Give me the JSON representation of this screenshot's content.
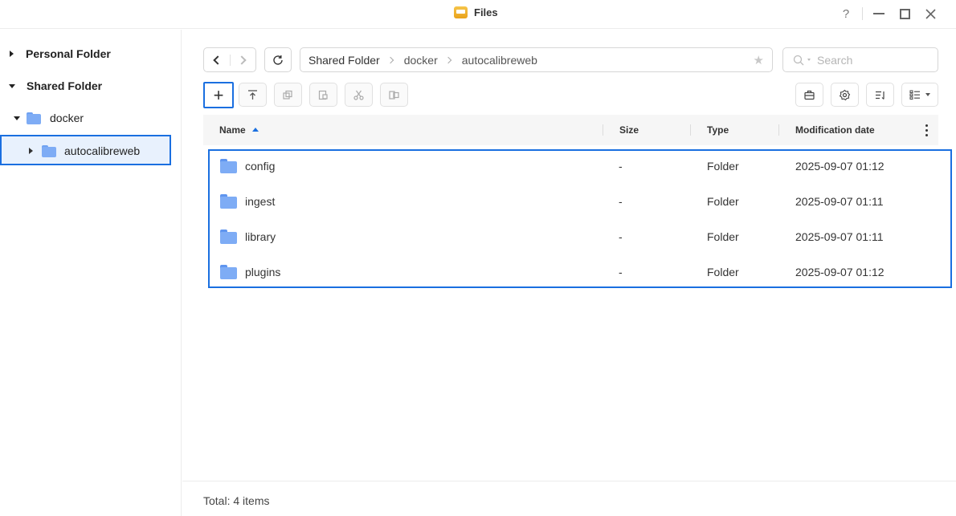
{
  "app": {
    "title": "Files",
    "icon": "files-app-icon"
  },
  "window_controls": {
    "help_label": "?"
  },
  "sidebar": {
    "items": [
      {
        "label": "Personal Folder",
        "expanded": false
      },
      {
        "label": "Shared Folder",
        "expanded": true
      },
      {
        "label": "docker",
        "expanded": true
      },
      {
        "label": "autocalibreweb",
        "expanded": false,
        "selected": true
      }
    ]
  },
  "path": {
    "crumbs": [
      "Shared Folder",
      "docker",
      "autocalibreweb"
    ]
  },
  "search": {
    "placeholder": "Search",
    "value": ""
  },
  "toolbar": {
    "create_label": "+",
    "icons": [
      "upload-icon",
      "copy-icon",
      "paste-icon",
      "cut-icon",
      "move-icon"
    ],
    "right_icons": [
      "briefcase-icon",
      "settings-icon",
      "sort-icon",
      "list-view-icon"
    ]
  },
  "table": {
    "columns": {
      "name": "Name",
      "size": "Size",
      "type": "Type",
      "modified": "Modification date"
    },
    "sort": {
      "column": "Name",
      "direction": "ascending"
    },
    "rows": [
      {
        "name": "config",
        "size": "-",
        "type": "Folder",
        "modified": "2025-09-07 01:12"
      },
      {
        "name": "ingest",
        "size": "-",
        "type": "Folder",
        "modified": "2025-09-07 01:11"
      },
      {
        "name": "library",
        "size": "-",
        "type": "Folder",
        "modified": "2025-09-07 01:11"
      },
      {
        "name": "plugins",
        "size": "-",
        "type": "Folder",
        "modified": "2025-09-07 01:12"
      }
    ]
  },
  "footer": {
    "total": "Total: 4 items"
  },
  "colors": {
    "accent": "#1a6fe0",
    "folder": "#7eacf5",
    "selected_bg": "#e8f1fd"
  }
}
